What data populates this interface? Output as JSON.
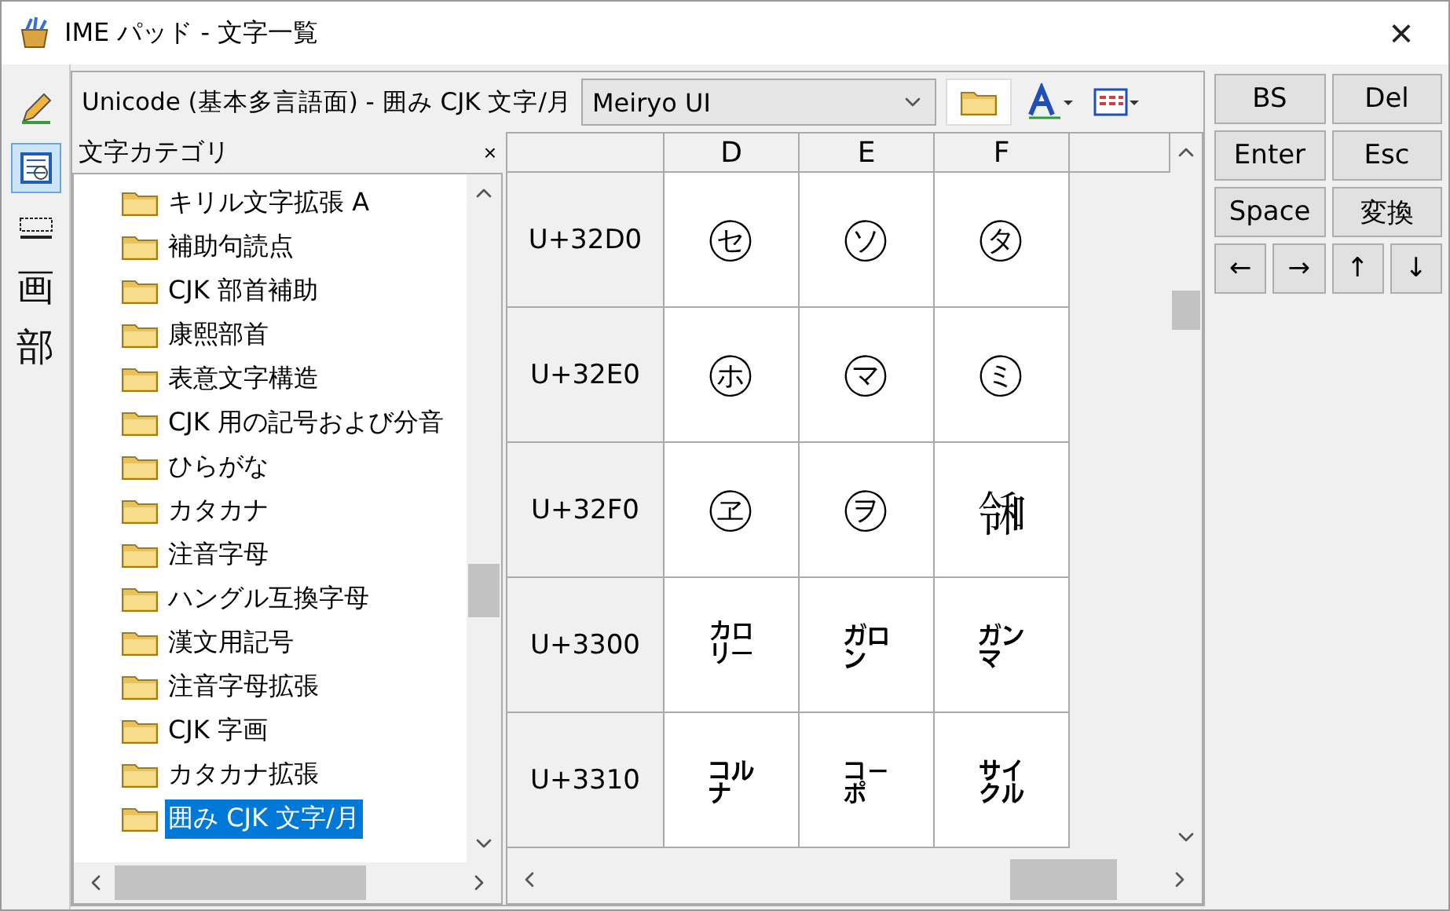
{
  "window": {
    "title": "IME パッド - 文字一覧",
    "close": "×"
  },
  "tools": [
    {
      "kind": "handwriting",
      "selected": false
    },
    {
      "kind": "list",
      "selected": true
    },
    {
      "kind": "keyboard",
      "selected": false
    },
    {
      "kind": "glyph",
      "label": "画",
      "selected": false
    },
    {
      "kind": "glyph",
      "label": "部",
      "selected": false
    }
  ],
  "header": {
    "title": "Unicode (基本多言語面) - 囲み CJK 文字/月",
    "font": "Meiryo UI"
  },
  "category_panel": {
    "title": "文字カテゴリ",
    "close": "×",
    "items": [
      {
        "label": "キリル文字拡張 A",
        "selected": false
      },
      {
        "label": "補助句読点",
        "selected": false
      },
      {
        "label": "CJK 部首補助",
        "selected": false
      },
      {
        "label": "康熙部首",
        "selected": false
      },
      {
        "label": "表意文字構造",
        "selected": false
      },
      {
        "label": "CJK 用の記号および分音",
        "selected": false
      },
      {
        "label": "ひらがな",
        "selected": false
      },
      {
        "label": "カタカナ",
        "selected": false
      },
      {
        "label": "注音字母",
        "selected": false
      },
      {
        "label": "ハングル互換字母",
        "selected": false
      },
      {
        "label": "漢文用記号",
        "selected": false
      },
      {
        "label": "注音字母拡張",
        "selected": false
      },
      {
        "label": "CJK 字画",
        "selected": false
      },
      {
        "label": "カタカナ拡張",
        "selected": false
      },
      {
        "label": "囲み CJK 文字/月",
        "selected": true
      }
    ]
  },
  "grid": {
    "columns": [
      "D",
      "E",
      "F"
    ],
    "rows": [
      {
        "code": "U+32D0",
        "cells": [
          "㋝",
          "㋞",
          "㋟"
        ]
      },
      {
        "code": "U+32E0",
        "cells": [
          "㋭",
          "㋮",
          "㋯"
        ]
      },
      {
        "code": "U+32F0",
        "cells": [
          "㋽",
          "㋾",
          "㋿"
        ]
      },
      {
        "code": "U+3300",
        "cells": [
          "㌍",
          "㌎",
          "㌏"
        ]
      },
      {
        "code": "U+3310",
        "cells": [
          "㌝",
          "㌞",
          "㌟"
        ]
      }
    ]
  },
  "keys": [
    "BS",
    "Del",
    "Enter",
    "Esc",
    "Space",
    "変換"
  ],
  "arrows": [
    "←",
    "→",
    "↑",
    "↓"
  ]
}
